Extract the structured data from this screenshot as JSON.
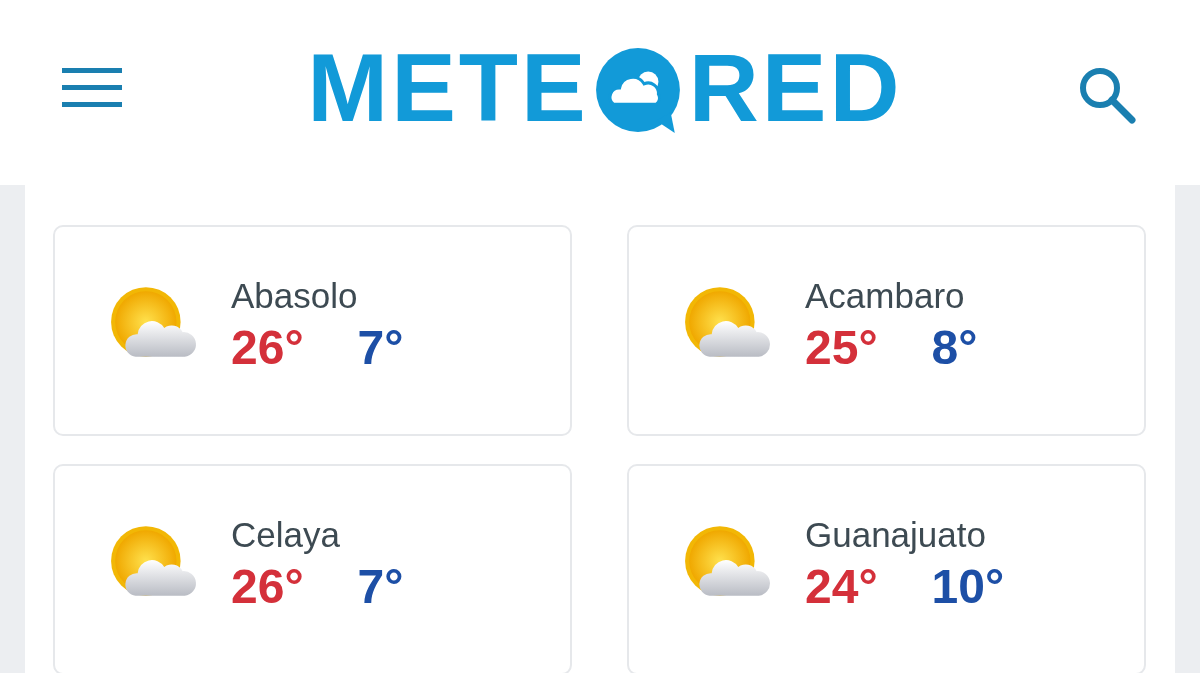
{
  "header": {
    "logo": {
      "before": "METE",
      "after": "RED"
    }
  },
  "cities": [
    {
      "name": "Abasolo",
      "high": "26°",
      "low": "7°"
    },
    {
      "name": "Acambaro",
      "high": "25°",
      "low": "8°"
    },
    {
      "name": "Celaya",
      "high": "26°",
      "low": "7°"
    },
    {
      "name": "Guanajuato",
      "high": "24°",
      "low": "10°"
    }
  ]
}
